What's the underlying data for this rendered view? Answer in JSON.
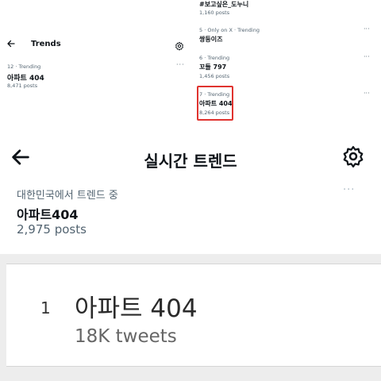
{
  "panel_a": {
    "title": "Trends",
    "icons": {
      "back": "back-arrow-icon",
      "settings": "gear-icon",
      "more": "more-icon"
    },
    "trend": {
      "meta": "12 · Trending",
      "name": "아파트 404",
      "posts": "8,471 posts",
      "more": "···"
    }
  },
  "panel_b": {
    "trends": [
      {
        "meta": "",
        "name": "#보고싶은_도누니",
        "posts": "1,160 posts",
        "more": ""
      },
      {
        "meta": "5 · Only on X · Trending",
        "name": "쌍둥이즈",
        "posts": "",
        "more": "···"
      },
      {
        "meta": "6 · Trending",
        "name": "꼬들 797",
        "posts": "1,456 posts",
        "more": "···"
      },
      {
        "meta": "7 · Trending",
        "name": "아파트 404",
        "posts": "8,264 posts",
        "more": "···"
      }
    ],
    "highlight_color": "#e0332f"
  },
  "panel_c": {
    "title": "실시간 트렌드",
    "trend": {
      "meta": "대한민국에서 트렌드 중",
      "name": "아파트404",
      "posts": "2,975 posts",
      "more": "···"
    }
  },
  "panel_d": {
    "rank": "1",
    "topic": "아파트 404",
    "tweets": "18K tweets"
  }
}
